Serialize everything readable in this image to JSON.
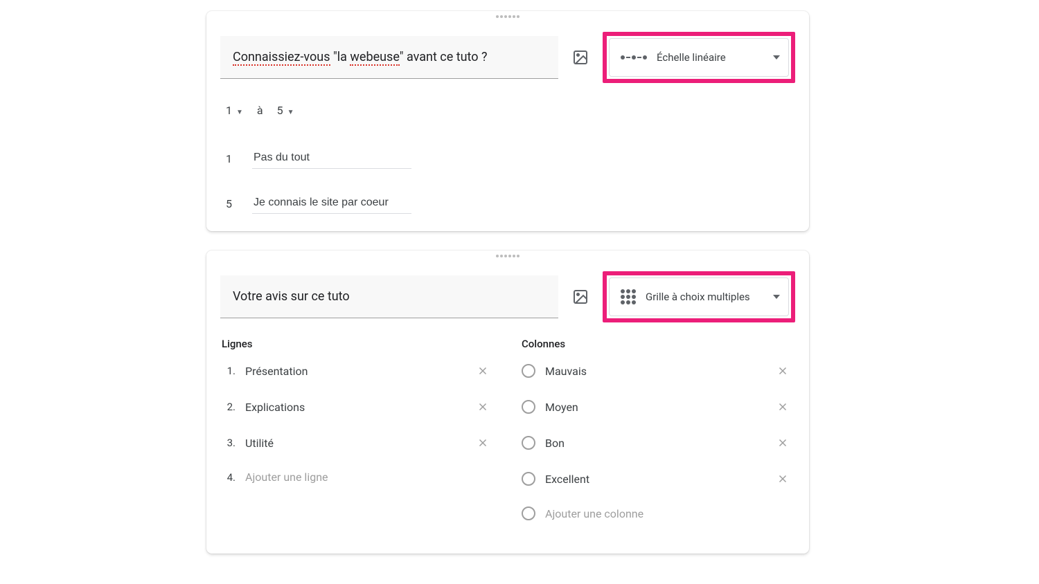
{
  "card1": {
    "question_html": "<span class='spell'>Connaissiez-vous</span> \"la <span class='spell'>webeuse</span>\"  avant ce tuto ?",
    "type_label": "Échelle linéaire",
    "range_from": "1",
    "range_sep": "à",
    "range_to": "5",
    "label_low_num": "1",
    "label_low_text": "Pas du tout",
    "label_high_num": "5",
    "label_high_text": "Je connais le site par coeur"
  },
  "card2": {
    "question": "Votre avis sur ce tuto",
    "type_label": "Grille à choix multiples",
    "rows_header": "Lignes",
    "cols_header": "Colonnes",
    "rows": [
      {
        "n": "1.",
        "label": "Présentation"
      },
      {
        "n": "2.",
        "label": "Explications"
      },
      {
        "n": "3.",
        "label": "Utilité"
      }
    ],
    "add_row_n": "4.",
    "add_row_label": "Ajouter une ligne",
    "cols": [
      {
        "label": "Mauvais"
      },
      {
        "label": "Moyen"
      },
      {
        "label": "Bon"
      },
      {
        "label": "Excellent"
      }
    ],
    "add_col_label": "Ajouter une colonne"
  }
}
